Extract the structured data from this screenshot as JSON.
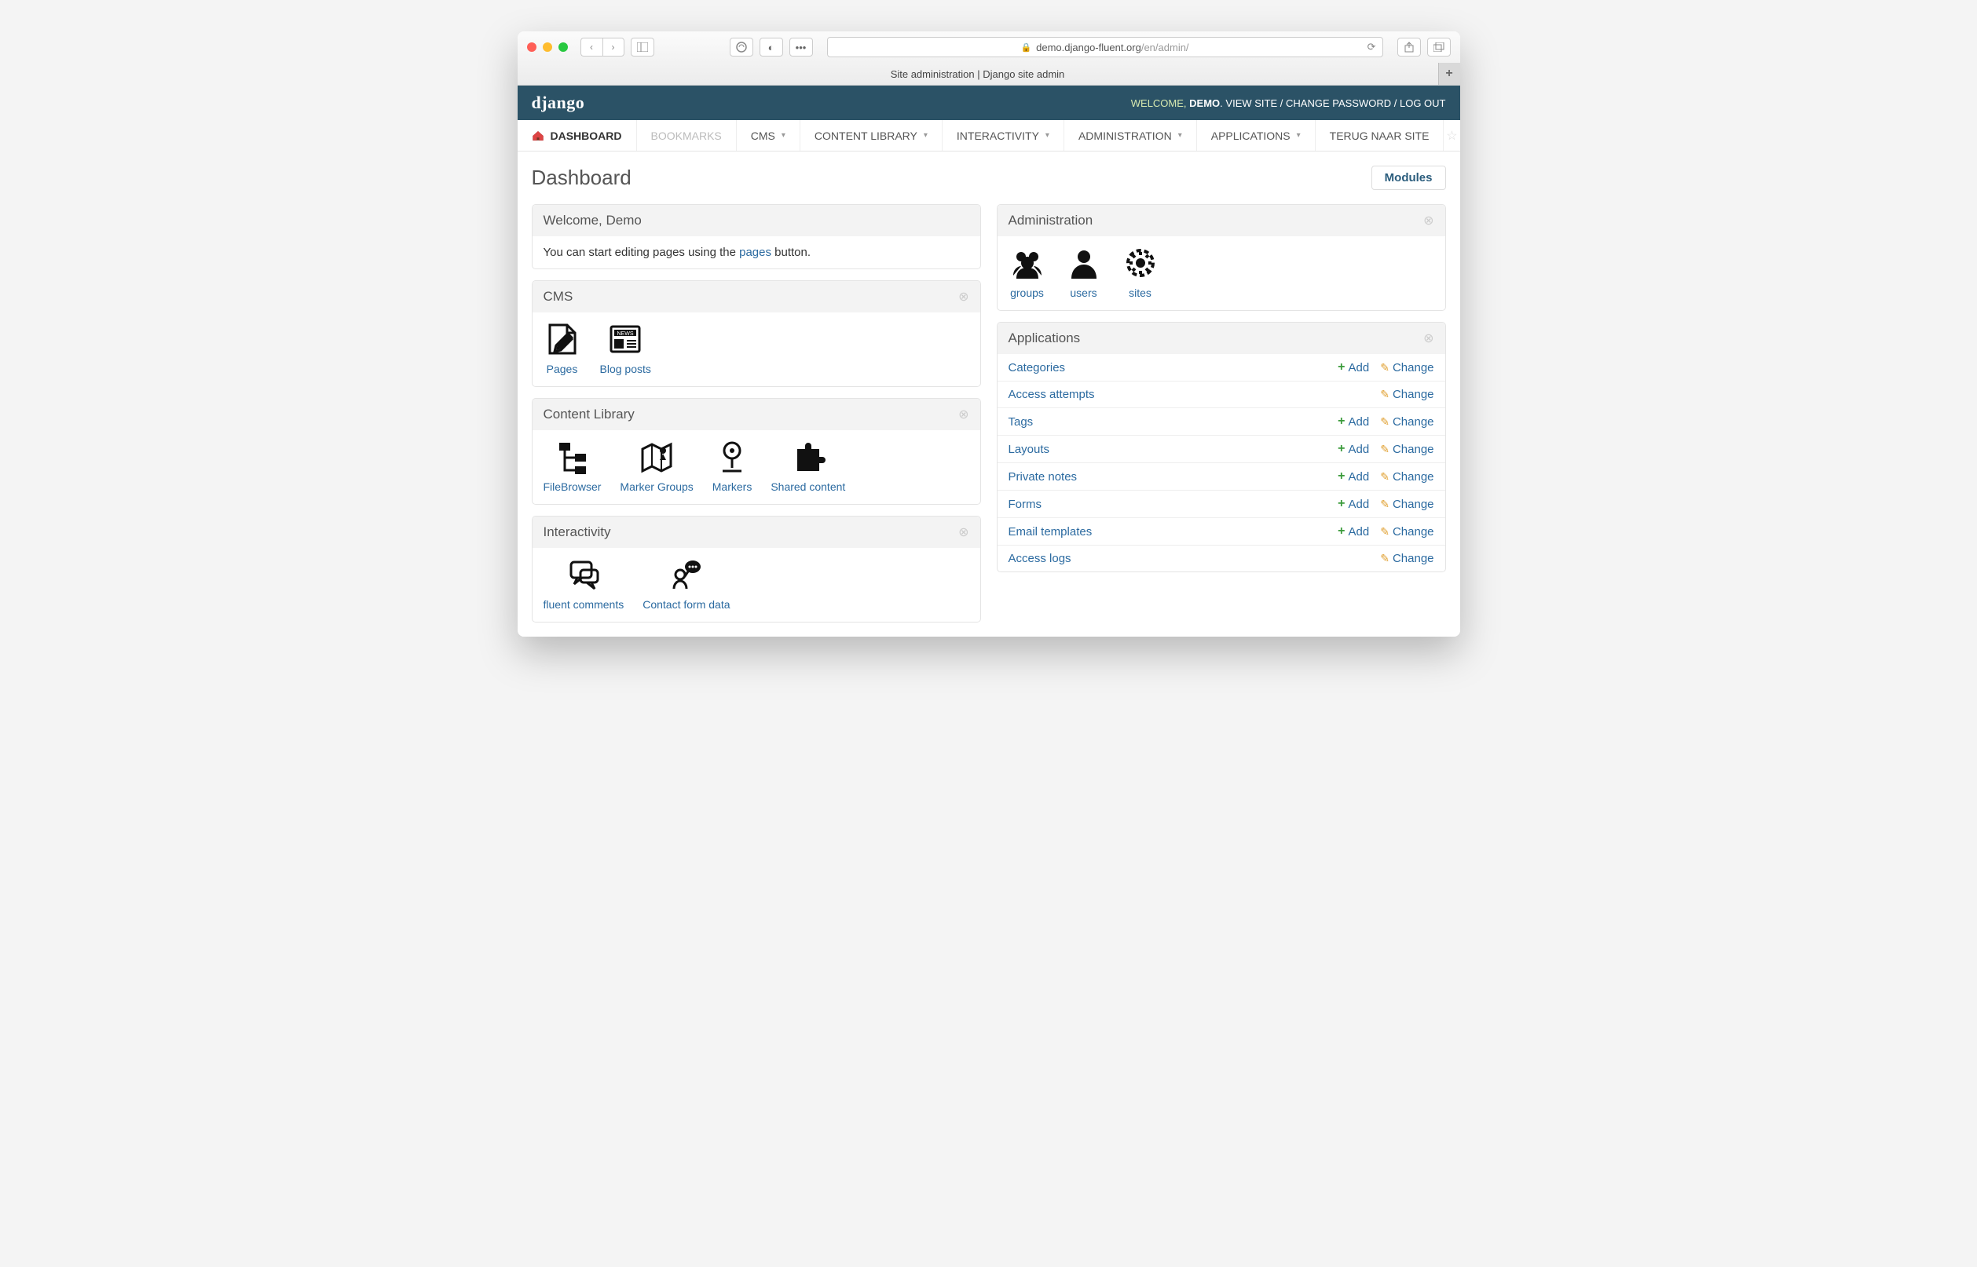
{
  "browser": {
    "url_host": "demo.django-fluent.org",
    "url_path": "/en/admin/",
    "tab_title": "Site administration | Django site admin"
  },
  "banner": {
    "logo": "django",
    "welcome": "WELCOME,",
    "user": "DEMO",
    "view_site": "VIEW SITE",
    "change_password": "CHANGE PASSWORD",
    "logout": "LOG OUT"
  },
  "nav": {
    "items": [
      {
        "label": "DASHBOARD",
        "active": true,
        "submenu": false,
        "icon": "home"
      },
      {
        "label": "BOOKMARKS",
        "disabled": true,
        "submenu": false
      },
      {
        "label": "CMS",
        "submenu": true
      },
      {
        "label": "CONTENT LIBRARY",
        "submenu": true
      },
      {
        "label": "INTERACTIVITY",
        "submenu": true
      },
      {
        "label": "ADMINISTRATION",
        "submenu": true
      },
      {
        "label": "APPLICATIONS",
        "submenu": true
      },
      {
        "label": "TERUG NAAR SITE",
        "submenu": false
      }
    ]
  },
  "page": {
    "title": "Dashboard",
    "modules_button": "Modules"
  },
  "welcome_panel": {
    "title": "Welcome, Demo",
    "body_prefix": "You can start editing pages using the ",
    "body_link": "pages",
    "body_suffix": " button."
  },
  "cms_panel": {
    "title": "CMS",
    "items": [
      {
        "label": "Pages",
        "icon": "edit-doc"
      },
      {
        "label": "Blog posts",
        "icon": "news"
      }
    ]
  },
  "library_panel": {
    "title": "Content Library",
    "items": [
      {
        "label": "FileBrowser",
        "icon": "tree"
      },
      {
        "label": "Marker Groups",
        "icon": "map"
      },
      {
        "label": "Markers",
        "icon": "pin"
      },
      {
        "label": "Shared content",
        "icon": "puzzle"
      }
    ]
  },
  "interactivity_panel": {
    "title": "Interactivity",
    "items": [
      {
        "label": "fluent comments",
        "icon": "comments"
      },
      {
        "label": "Contact form data",
        "icon": "contact"
      }
    ]
  },
  "admin_panel": {
    "title": "Administration",
    "items": [
      {
        "label": "groups",
        "icon": "group"
      },
      {
        "label": "users",
        "icon": "user"
      },
      {
        "label": "sites",
        "icon": "globe-gear"
      }
    ]
  },
  "apps_panel": {
    "title": "Applications",
    "rows": [
      {
        "name": "Categories",
        "add": true,
        "change": true
      },
      {
        "name": "Access attempts",
        "add": false,
        "change": true
      },
      {
        "name": "Tags",
        "add": true,
        "change": true
      },
      {
        "name": "Layouts",
        "add": true,
        "change": true
      },
      {
        "name": "Private notes",
        "add": true,
        "change": true
      },
      {
        "name": "Forms",
        "add": true,
        "change": true
      },
      {
        "name": "Email templates",
        "add": true,
        "change": true
      },
      {
        "name": "Access logs",
        "add": false,
        "change": true
      }
    ],
    "add_label": "Add",
    "change_label": "Change"
  }
}
